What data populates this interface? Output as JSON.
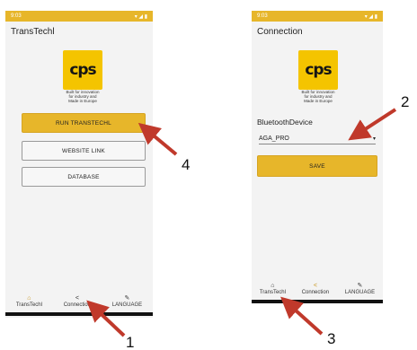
{
  "left_screen": {
    "status_time": "9:03",
    "status_icons": "▾ ◢ ▮",
    "title": "TransTechl",
    "logo_text": "cps",
    "logo_tagline": [
      "Built for innovation",
      "for industry and",
      "Made in Europe"
    ],
    "buttons": [
      "RUN TRANSTECHL",
      "WEBSITE LINK",
      "DATABASE"
    ],
    "nav": [
      {
        "icon": "home-icon",
        "label": "TransTechl"
      },
      {
        "icon": "share-icon",
        "label": "Connection"
      },
      {
        "icon": "wrench-icon",
        "label": "LANGUAGE"
      }
    ],
    "active_nav": 0
  },
  "right_screen": {
    "status_time": "9:03",
    "status_icons": "▾ ◢ ▮",
    "title": "Connection",
    "logo_text": "cps",
    "logo_tagline": [
      "Built for innovation",
      "for industry and",
      "Made in Europe"
    ],
    "device_label": "BluetoothDevice",
    "device_value": "AGA_PRO",
    "save_label": "SAVE",
    "nav": [
      {
        "icon": "home-icon",
        "label": "TransTechl"
      },
      {
        "icon": "share-icon",
        "label": "Connection"
      },
      {
        "icon": "wrench-icon",
        "label": "LANGUAGE"
      }
    ],
    "active_nav": 1
  },
  "callouts": [
    "1",
    "2",
    "3",
    "4"
  ],
  "colors": {
    "accent": "#e7b62a",
    "arrow": "#c0392b"
  }
}
